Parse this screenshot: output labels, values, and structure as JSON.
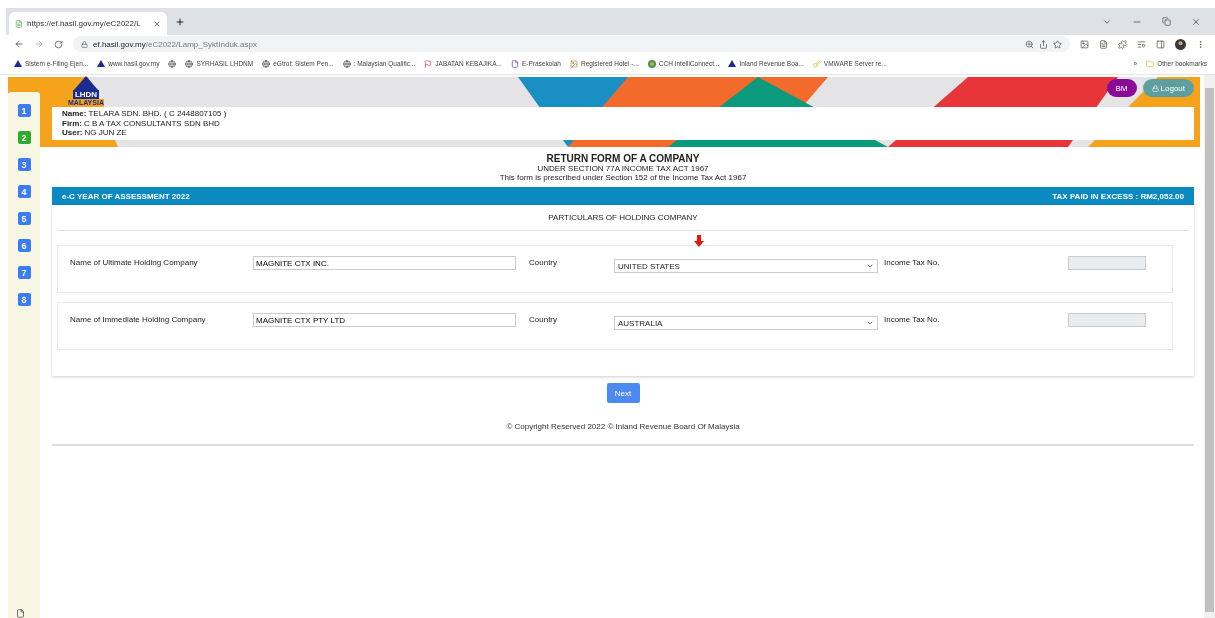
{
  "browser": {
    "tab": {
      "title": "https://ef.hasil.gov.my/eC2022/L"
    },
    "url": {
      "host": "ef.hasil.gov.my",
      "path": "/eC2022/Lamp_SyktInduk.aspx"
    },
    "bookmarks": [
      {
        "kind": "triangle",
        "label": "Sistem e-Filing Ejen..."
      },
      {
        "kind": "triangle",
        "label": "www.hasil.gov.my"
      },
      {
        "kind": "globe"
      },
      {
        "kind": "globe",
        "label": "SYRHASIL LHDNM"
      },
      {
        "kind": "globe",
        "label": "eGtrof: Sistem Pen..."
      },
      {
        "kind": "globe",
        "label": ": Malaysian Qualific..."
      },
      {
        "kind": "flag",
        "label": "JABATAN KEBAJIKA..."
      },
      {
        "kind": "letter",
        "label": "E-Prasekolah"
      },
      {
        "kind": "crest",
        "label": "Registered Hotel -..."
      },
      {
        "kind": "wheel",
        "label": "CCH IntelliConnect..."
      },
      {
        "kind": "triangle",
        "label": "Inland Revenue Boa..."
      },
      {
        "kind": "key",
        "label": "VMWARE Server re..."
      }
    ],
    "more": "»",
    "other_bookmarks": "Other bookmarks"
  },
  "logo": {
    "name": "LHDN",
    "country": "MALAYSIA"
  },
  "header_buttons": [
    {
      "kind": "language",
      "label": "BM"
    },
    {
      "kind": "logout",
      "label": "Logout"
    }
  ],
  "sidebar": {
    "items": [
      {
        "label": "1",
        "selected": false
      },
      {
        "label": "2",
        "selected": true
      },
      {
        "label": "3",
        "selected": false
      },
      {
        "label": "4",
        "selected": false
      },
      {
        "label": "5",
        "selected": false
      },
      {
        "label": "6",
        "selected": false
      },
      {
        "label": "7",
        "selected": false
      },
      {
        "label": "8",
        "selected": false
      }
    ]
  },
  "user_info": [
    {
      "label": "Name:",
      "value": "TELARA SDN. BHD. ( C 2448807105 )"
    },
    {
      "label": "Firm:",
      "value": "C B A TAX CONSULTANTS SDN BHD"
    },
    {
      "label": "User:",
      "value": "NG JUN ZE"
    }
  ],
  "form": {
    "title": "RETURN FORM OF A COMPANY",
    "subtitle": "UNDER SECTION 77A INCOME TAX ACT 1967",
    "note": "This form is prescribed under Section 152 of the Income Tax Act 1967"
  },
  "bar": {
    "left": "e-C YEAR OF ASSESSMENT  2022",
    "right": "TAX PAID IN EXCESS : RM2,052.00"
  },
  "section": {
    "title": "PARTICULARS OF HOLDING COMPANY",
    "rows": [
      {
        "label": "Name of Ultimate Holding Company",
        "company": "MAGNITE CTX INC.",
        "country_label": "Country",
        "country": "UNITED STATES",
        "tax_label": "Income Tax No.",
        "marked": true
      },
      {
        "label": "Name of Immediate Holding Company",
        "company": "MAGNITE CTX PTY LTD",
        "country_label": "Country",
        "country": "AUSTRALIA",
        "tax_label": "Income Tax No.",
        "marked": false
      }
    ]
  },
  "next_button": "Next",
  "copyright": "© Copyright Reserved 2022 © Inland Revenue Board Of Malaysia"
}
